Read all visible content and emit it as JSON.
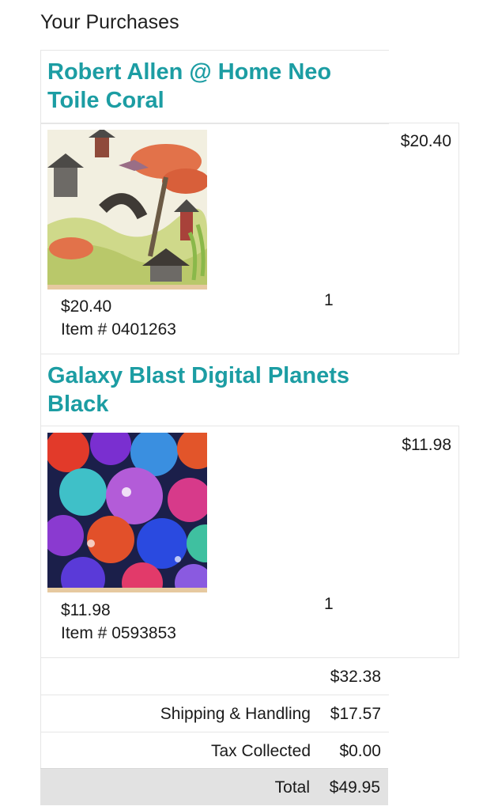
{
  "page": {
    "heading": "Your Purchases"
  },
  "items": [
    {
      "title": "Robert Allen @ Home Neo Toile Coral",
      "line_total": "$20.40",
      "unit_price": "$20.40",
      "item_number": "Item # 0401263",
      "quantity": "1",
      "image": "neo-toile-coral-fabric-swatch"
    },
    {
      "title": "Galaxy Blast Digital Planets Black",
      "line_total": "$11.98",
      "unit_price": "$11.98",
      "item_number": "Item # 0593853",
      "quantity": "1",
      "image": "galaxy-blast-planets-fabric-swatch"
    }
  ],
  "summary": {
    "subtotal": "$32.38",
    "shipping_label": "Shipping & Handling",
    "shipping": "$17.57",
    "tax_label": "Tax Collected",
    "tax": "$0.00",
    "total_label": "Total",
    "total": "$49.95"
  },
  "colors": {
    "title": "#1c9da3",
    "total_row_bg": "#e2e2e2",
    "border": "#e6e6e6"
  }
}
